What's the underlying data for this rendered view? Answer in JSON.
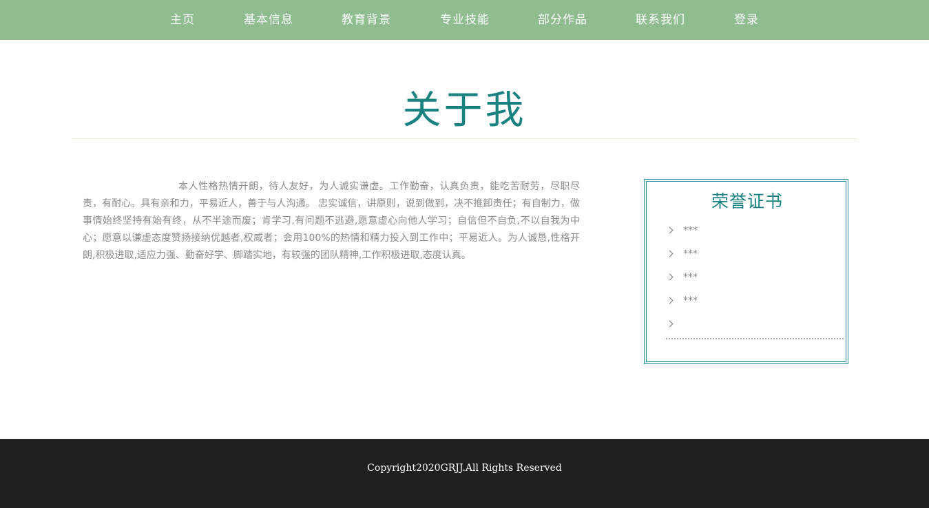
{
  "nav": {
    "items": [
      "主页",
      "基本信息",
      "教育背景",
      "专业技能",
      "部分作品",
      "联系我们",
      "登录"
    ]
  },
  "about": {
    "title": "关于我",
    "intro": "本人性格热情开朗，待人友好，为人诚实谦虚。工作勤奋，认真负责，能吃苦耐劳，尽职尽责，有耐心。具有亲和力，平易近人，善于与人沟通。 忠实诚信，讲原则，说到做到，决不推卸责任；有自制力，做事情始终坚持有始有终，从不半途而废；肯学习,有问题不逃避,愿意虚心向他人学习；自信但不自负,不以自我为中心；愿意以谦虚态度赞扬接纳优越者,权威者；会用100%的热情和精力投入到工作中；平易近人。为人诚恳,性格开朗,积极进取,适应力强、勤奋好学、脚踏实地，有较强的团队精神,工作积极进取,态度认真。"
  },
  "honor": {
    "title": "荣誉证书",
    "items": [
      "***",
      "***",
      "***",
      "***",
      ""
    ]
  },
  "footer": {
    "copyright": "Copyright2020GRJJ.All Rights Reserved"
  },
  "colors": {
    "nav_bg": "#8fbd90",
    "accent": "#1a8181",
    "footer_bg": "#1f1f1f"
  }
}
